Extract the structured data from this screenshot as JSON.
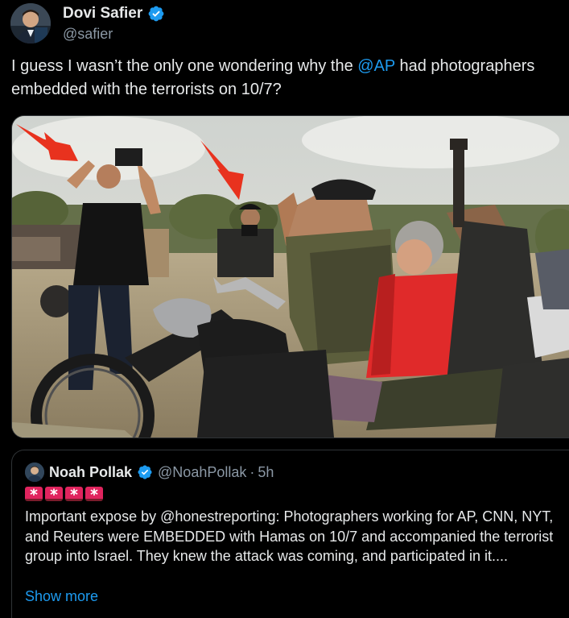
{
  "tweet": {
    "author": {
      "display_name": "Dovi Safier",
      "handle": "@safier",
      "verified": true,
      "avatar_icon": "profile-photo-icon"
    },
    "text_before": "I guess I wasn’t the only one wondering why the ",
    "mention": "@AP",
    "text_after": " had photographers embedded with the terrorists on 10/7?",
    "media": {
      "description_icon": "photo-image"
    }
  },
  "quote": {
    "author": {
      "display_name": "Noah Pollak",
      "handle": "@NoahPollak",
      "separator": "·",
      "time": "5h",
      "verified": true
    },
    "emoji": [
      "siren-emoji",
      "siren-emoji",
      "siren-emoji",
      "siren-emoji"
    ],
    "text": "Important expose by @honestreporting: Photographers working for AP, CNN, NYT, and Reuters were EMBEDDED with Hamas on 10/7 and accompanied the terrorist group into Israel. They knew the attack was coming, and participated in it....",
    "show_more": "Show more"
  },
  "colors": {
    "background": "#000000",
    "text_primary": "#e7e9ea",
    "text_secondary": "#8b98a5",
    "link": "#1d9bf0",
    "verified_badge": "#1d9bf0",
    "border": "#2f3336",
    "siren": "#e0245e",
    "arrow": "#e8321e"
  }
}
